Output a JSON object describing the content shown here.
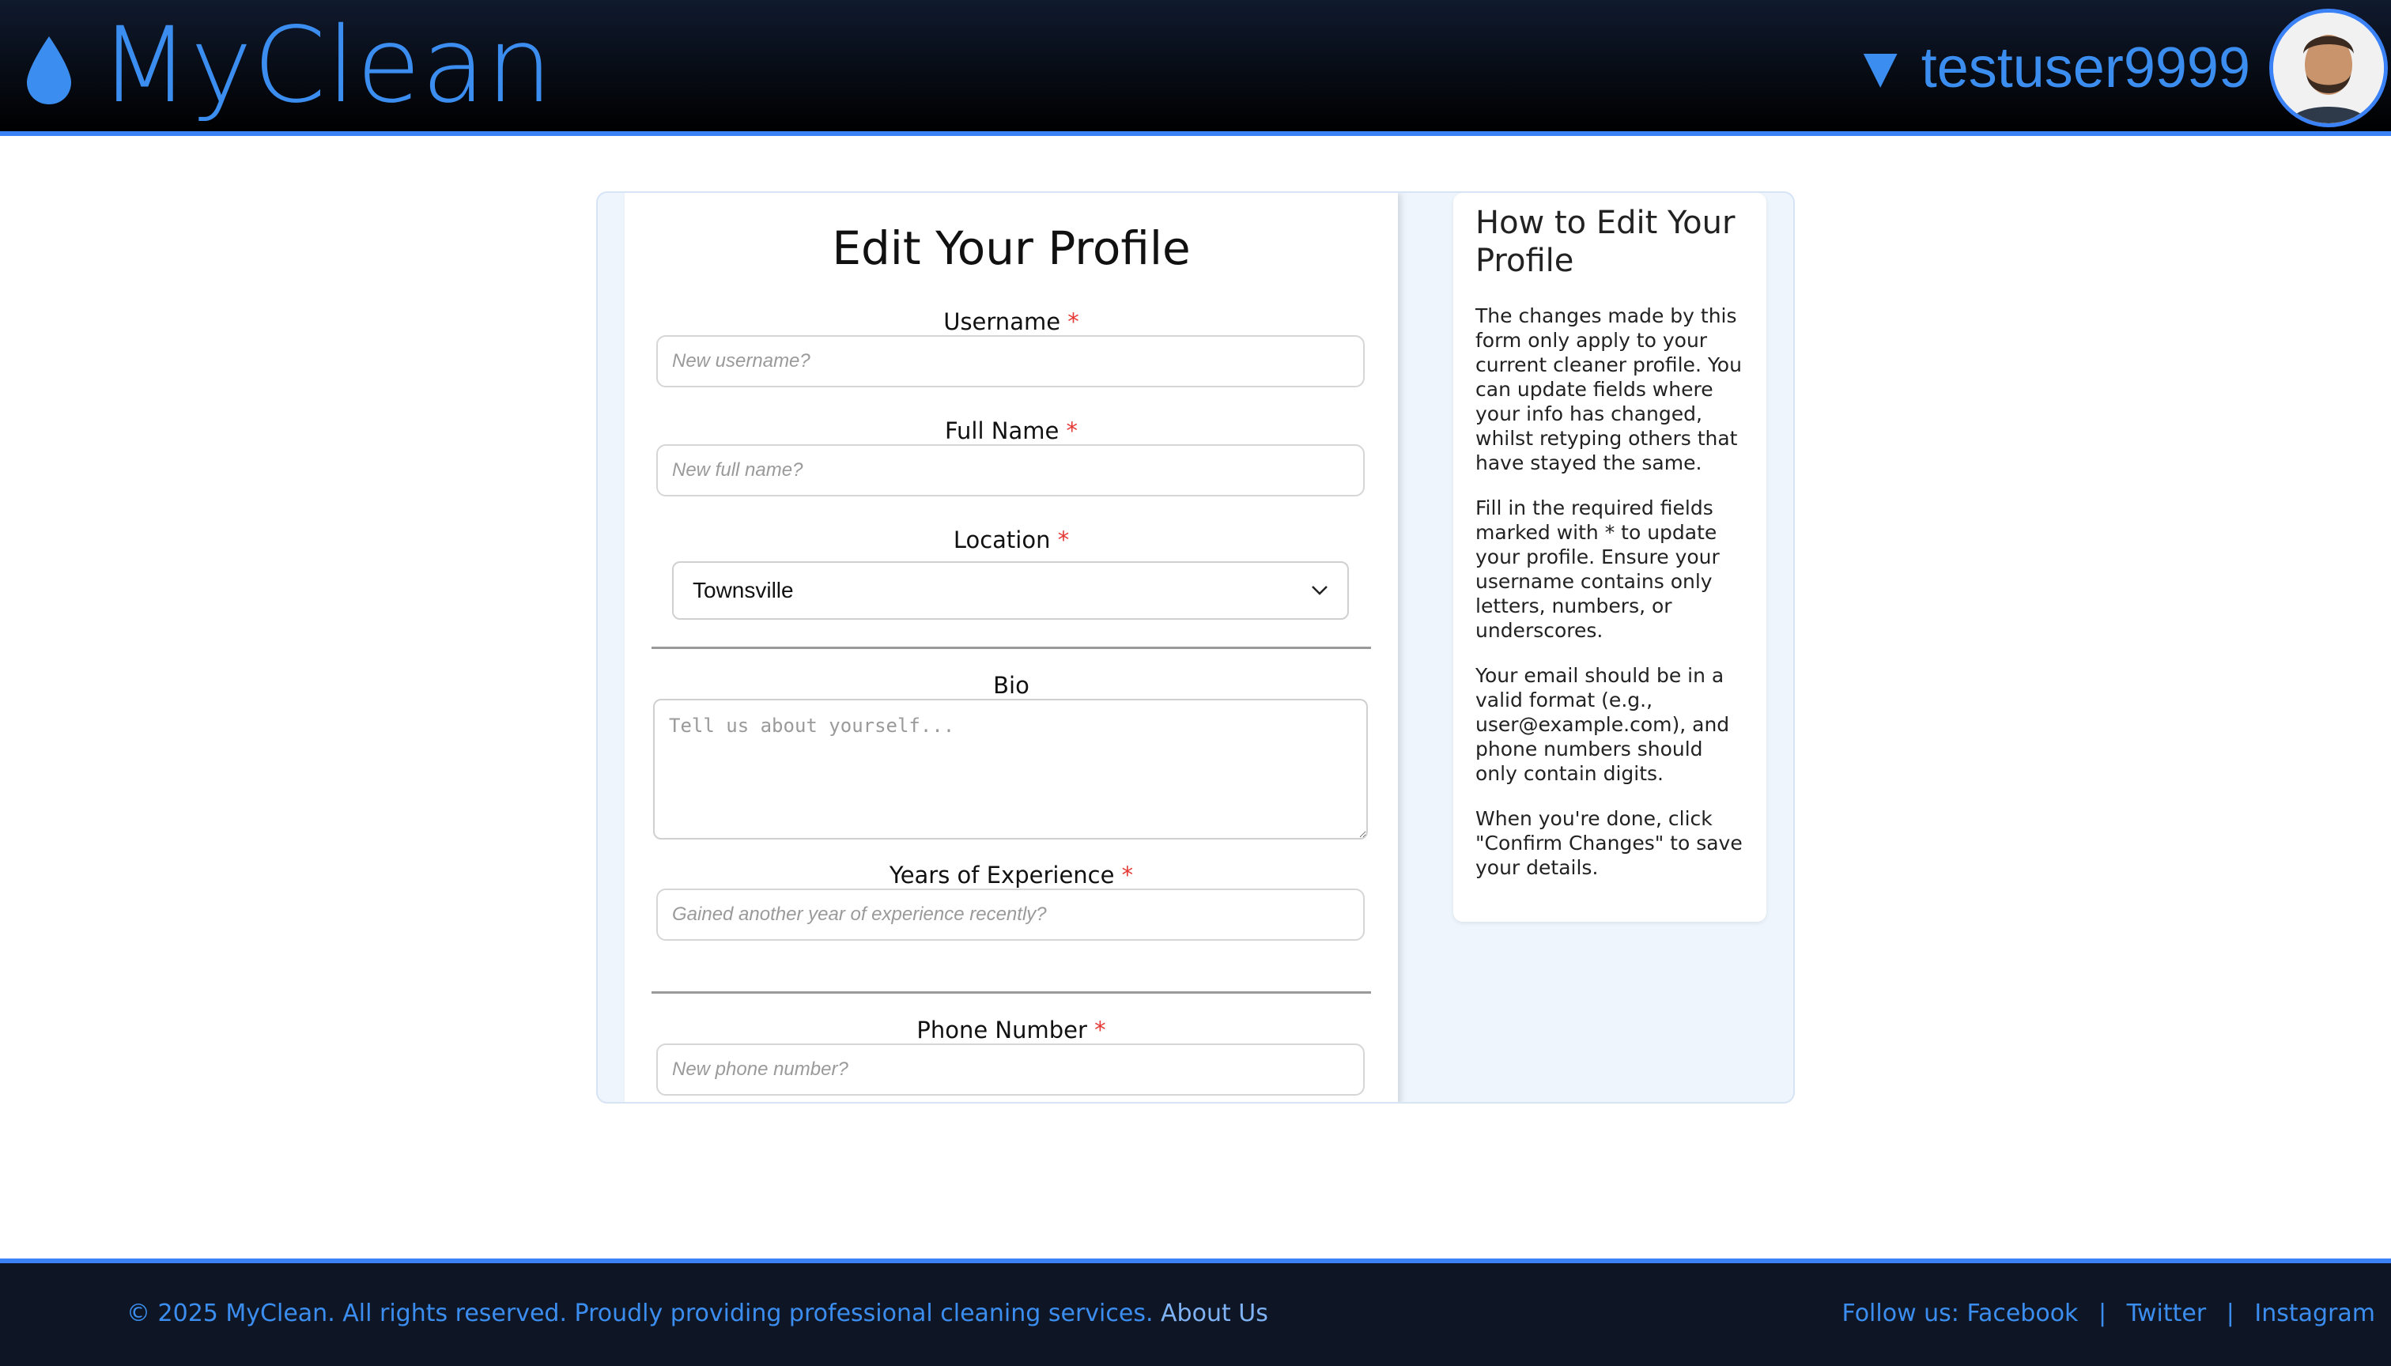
{
  "header": {
    "brand": "MyClean",
    "username": "testuser9999",
    "icons": {
      "logo": "water-drop-icon",
      "caret": "caret-down-icon",
      "avatar": "user-avatar"
    }
  },
  "form": {
    "title": "Edit Your Profile",
    "required_mark": "*",
    "username": {
      "label": "Username",
      "placeholder": "New username?",
      "value": ""
    },
    "full_name": {
      "label": "Full Name",
      "placeholder": "New full name?",
      "value": ""
    },
    "location": {
      "label": "Location",
      "selected": "Townsville"
    },
    "bio": {
      "label": "Bio",
      "placeholder": "Tell us about yourself...",
      "value": ""
    },
    "experience": {
      "label": "Years of Experience",
      "placeholder": "Gained another year of experience recently?",
      "value": ""
    },
    "phone": {
      "label": "Phone Number",
      "placeholder": "New phone number?",
      "value": ""
    }
  },
  "help": {
    "title": "How to Edit Your Profile",
    "paragraphs": [
      "The changes made by this form only apply to your current cleaner profile. You can update fields where your info has changed, whilst retyping others that have stayed the same.",
      "Fill in the required fields marked with * to update your profile. Ensure your username contains only letters, numbers, or underscores.",
      "Your email should be in a valid format (e.g., user@example.com), and phone numbers should only contain digits.",
      "When you're done, click \"Confirm Changes\" to save your details."
    ]
  },
  "footer": {
    "copyright": "© 2025 MyClean. All rights reserved. Proudly providing professional cleaning services.",
    "about": "About Us",
    "follow": "Follow us:",
    "facebook": "Facebook",
    "twitter": "Twitter",
    "instagram": "Instagram",
    "separator": "|"
  },
  "colors": {
    "accent": "#3b8ef0",
    "header_bg": "#0b1220",
    "required": "#e53935",
    "card_bg": "#eef5fd"
  }
}
